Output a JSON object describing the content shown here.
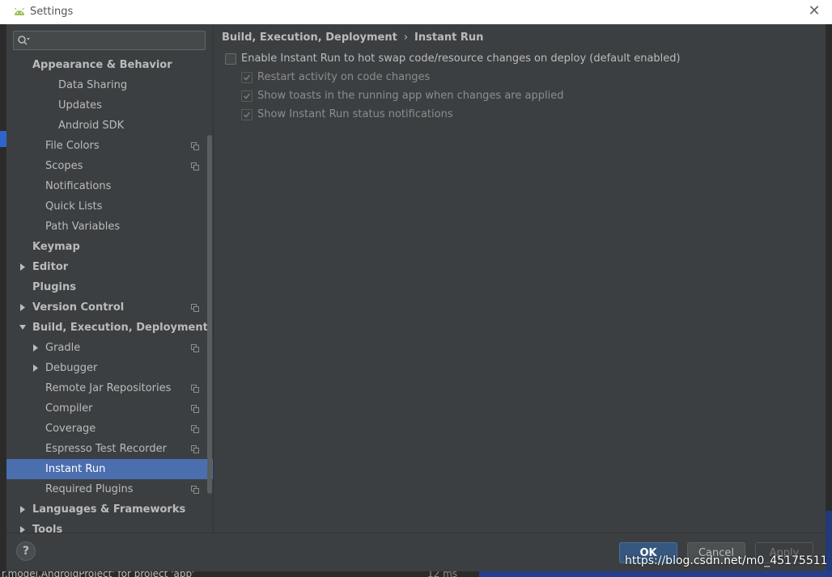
{
  "window": {
    "title": "Settings",
    "close_glyph": "✕"
  },
  "search": {
    "placeholder": "",
    "icon": "search-icon"
  },
  "tree": [
    {
      "label": "Appearance & Behavior",
      "bold": true,
      "indent": 0,
      "arrow": null,
      "icon": false
    },
    {
      "label": "Data Sharing",
      "bold": false,
      "indent": 2,
      "arrow": null,
      "icon": false
    },
    {
      "label": "Updates",
      "bold": false,
      "indent": 2,
      "arrow": null,
      "icon": false
    },
    {
      "label": "Android SDK",
      "bold": false,
      "indent": 2,
      "arrow": null,
      "icon": false
    },
    {
      "label": "File Colors",
      "bold": false,
      "indent": 1,
      "arrow": null,
      "icon": true
    },
    {
      "label": "Scopes",
      "bold": false,
      "indent": 1,
      "arrow": null,
      "icon": true
    },
    {
      "label": "Notifications",
      "bold": false,
      "indent": 1,
      "arrow": null,
      "icon": false
    },
    {
      "label": "Quick Lists",
      "bold": false,
      "indent": 1,
      "arrow": null,
      "icon": false
    },
    {
      "label": "Path Variables",
      "bold": false,
      "indent": 1,
      "arrow": null,
      "icon": false
    },
    {
      "label": "Keymap",
      "bold": true,
      "indent": 0,
      "arrow": null,
      "icon": false
    },
    {
      "label": "Editor",
      "bold": true,
      "indent": 0,
      "arrow": "right",
      "icon": false
    },
    {
      "label": "Plugins",
      "bold": true,
      "indent": 0,
      "arrow": null,
      "icon": false
    },
    {
      "label": "Version Control",
      "bold": true,
      "indent": 0,
      "arrow": "right",
      "icon": true
    },
    {
      "label": "Build, Execution, Deployment",
      "bold": true,
      "indent": 0,
      "arrow": "down",
      "icon": false
    },
    {
      "label": "Gradle",
      "bold": false,
      "indent": 1,
      "arrow": "right",
      "icon": true
    },
    {
      "label": "Debugger",
      "bold": false,
      "indent": 1,
      "arrow": "right",
      "icon": false
    },
    {
      "label": "Remote Jar Repositories",
      "bold": false,
      "indent": 1,
      "arrow": null,
      "icon": true
    },
    {
      "label": "Compiler",
      "bold": false,
      "indent": 1,
      "arrow": null,
      "icon": true
    },
    {
      "label": "Coverage",
      "bold": false,
      "indent": 1,
      "arrow": null,
      "icon": true
    },
    {
      "label": "Espresso Test Recorder",
      "bold": false,
      "indent": 1,
      "arrow": null,
      "icon": true
    },
    {
      "label": "Instant Run",
      "bold": false,
      "indent": 1,
      "arrow": null,
      "icon": false,
      "selected": true
    },
    {
      "label": "Required Plugins",
      "bold": false,
      "indent": 1,
      "arrow": null,
      "icon": true
    },
    {
      "label": "Languages & Frameworks",
      "bold": true,
      "indent": 0,
      "arrow": "right",
      "icon": false
    },
    {
      "label": "Tools",
      "bold": true,
      "indent": 0,
      "arrow": "right",
      "icon": false
    }
  ],
  "breadcrumb": {
    "parent": "Build, Execution, Deployment",
    "separator": "›",
    "current": "Instant Run"
  },
  "options": [
    {
      "label": "Enable Instant Run to hot swap code/resource changes on deploy (default enabled)",
      "checked": false,
      "disabled": false,
      "level": 0
    },
    {
      "label": "Restart activity on code changes",
      "checked": true,
      "disabled": true,
      "level": 1
    },
    {
      "label": "Show toasts in the running app when changes are applied",
      "checked": true,
      "disabled": true,
      "level": 1
    },
    {
      "label": "Show Instant Run status notifications",
      "checked": true,
      "disabled": true,
      "level": 1
    }
  ],
  "footer": {
    "help": "?",
    "ok": "OK",
    "cancel": "Cancel",
    "apply": "Apply"
  },
  "background": {
    "status_text": "r.model.AndroidProject' for project 'app'",
    "status_time": "12 ms"
  },
  "watermark": "https://blog.csdn.net/m0_45175511",
  "colors": {
    "selection": "#4b6eaf",
    "background": "#3c3f41",
    "ok_button": "#365880"
  }
}
